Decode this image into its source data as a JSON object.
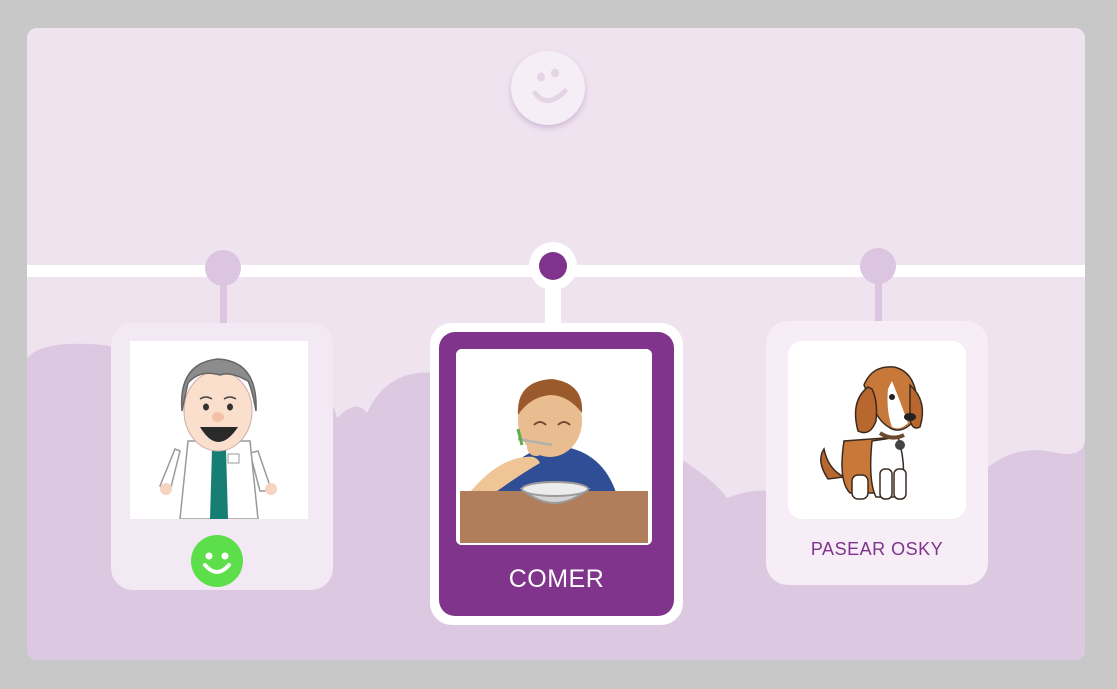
{
  "timeline": {
    "items": [
      {
        "label": "",
        "image": "doctor-picture",
        "status": "done",
        "status_icon": "green-smiley-icon"
      },
      {
        "label": "COMER",
        "image": "child-eating-picture",
        "status": "current"
      },
      {
        "label": "PASEAR OSKY",
        "image": "beagle-dog-picture",
        "status": "upcoming"
      }
    ]
  },
  "header": {
    "icon": "smiley-icon"
  },
  "colors": {
    "frame_border": "#c8c8c8",
    "background": "#efe3f0",
    "hills": "#ddc8e1",
    "accent": "#80348c",
    "done": "#5dde4b"
  }
}
